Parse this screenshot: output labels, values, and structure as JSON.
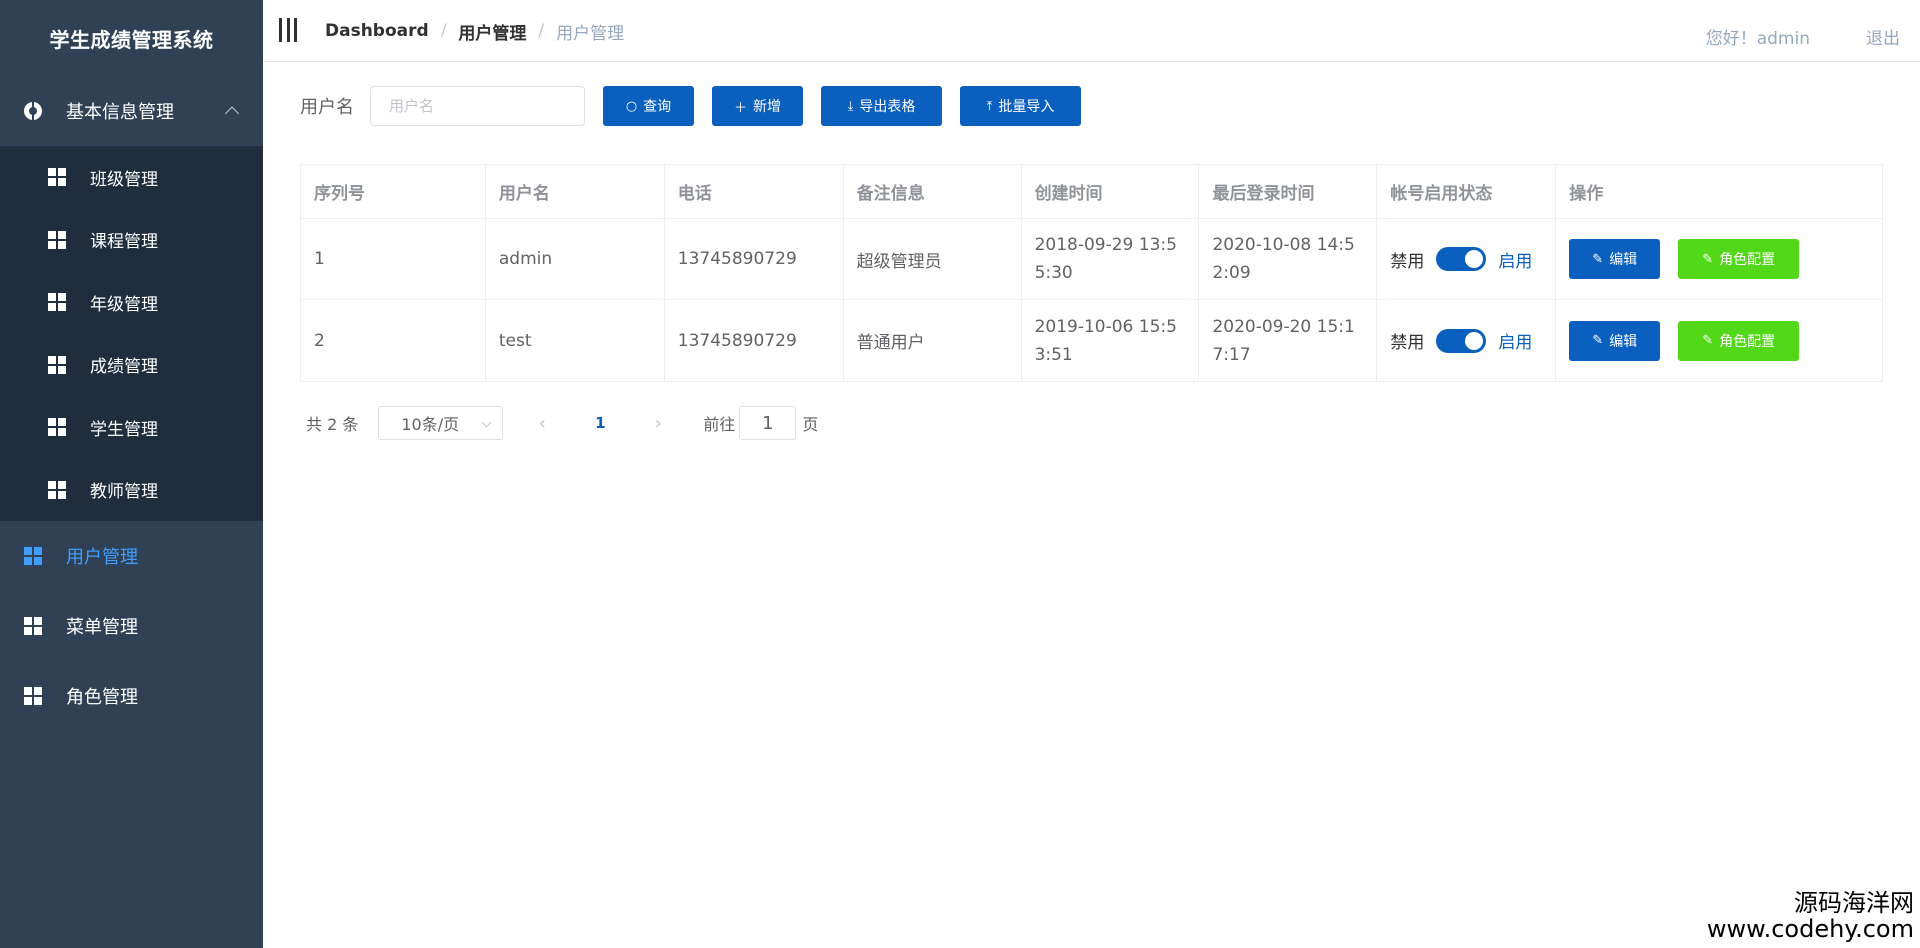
{
  "app": {
    "title": "学生成绩管理系统"
  },
  "sidebar": {
    "group": {
      "label": "基本信息管理",
      "icon": "target-icon"
    },
    "submenu": [
      {
        "label": "班级管理",
        "icon": "grid-icon"
      },
      {
        "label": "课程管理",
        "icon": "grid-icon"
      },
      {
        "label": "年级管理",
        "icon": "grid-icon"
      },
      {
        "label": "成绩管理",
        "icon": "grid-icon"
      },
      {
        "label": "学生管理",
        "icon": "grid-icon"
      },
      {
        "label": "教师管理",
        "icon": "grid-icon"
      }
    ],
    "items": [
      {
        "label": "用户管理",
        "icon": "grid-icon",
        "active": true
      },
      {
        "label": "菜单管理",
        "icon": "grid-icon"
      },
      {
        "label": "角色管理",
        "icon": "grid-icon"
      }
    ],
    "active_color": "#409eff",
    "bg_color": "#304156"
  },
  "header": {
    "breadcrumb": [
      "Dashboard",
      "用户管理",
      "用户管理"
    ],
    "greeting": "您好！admin",
    "logout": "退出"
  },
  "search": {
    "label": "用户名",
    "placeholder": "用户名",
    "value": "",
    "buttons": {
      "query": "查询",
      "add": "新增",
      "export": "导出表格",
      "import": "批量导入"
    }
  },
  "table": {
    "columns": [
      "序列号",
      "用户名",
      "电话",
      "备注信息",
      "创建时间",
      "最后登录时间",
      "帐号启用状态",
      "操作"
    ],
    "rows": [
      {
        "id": "1",
        "username": "admin",
        "phone": "13745890729",
        "remark": "超级管理员",
        "created": "2018-09-29 13:55:30",
        "last_login": "2020-10-08 14:52:09",
        "status_off": "禁用",
        "status_on": "启用",
        "enabled": true,
        "edit": "编辑",
        "role": "角色配置"
      },
      {
        "id": "2",
        "username": "test",
        "phone": "13745890729",
        "remark": "普通用户",
        "created": "2019-10-06 15:53:51",
        "last_login": "2020-09-20 15:17:17",
        "status_off": "禁用",
        "status_on": "启用",
        "enabled": true,
        "edit": "编辑",
        "role": "角色配置"
      }
    ]
  },
  "pagination": {
    "total": "共 2 条",
    "page_size": "10条/页",
    "current_page": "1",
    "goto_label": "前往",
    "goto_value": "1",
    "page_suffix": "页"
  },
  "watermark": {
    "line1": "源码海洋网",
    "line2": "www.codehy.com"
  },
  "colors": {
    "primary": "#0a5fbf",
    "success": "#52d819"
  }
}
